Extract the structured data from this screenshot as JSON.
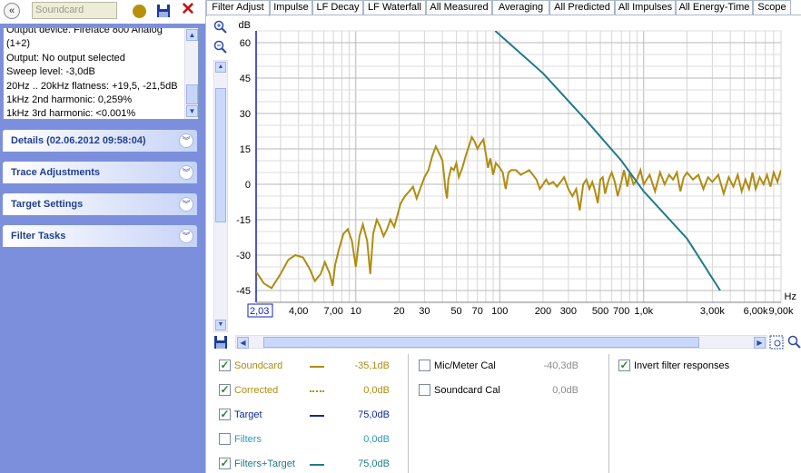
{
  "left_panel": {
    "back_label": "«",
    "measurement_name": "Soundcard",
    "info_lines": [
      "Output device: Fireface 800 Analog",
      "(1+2)",
      "Output: No output selected",
      "Sweep level: -3,0dB",
      "20Hz .. 20kHz flatness: +19,5, -21,5dB",
      "1kHz 2nd harmonic: 0,259%",
      "1kHz 3rd harmonic: <0.001%"
    ],
    "sections": [
      {
        "title": "Details  (02.06.2012 09:58:04)"
      },
      {
        "title": "Trace Adjustments"
      },
      {
        "title": "Target Settings"
      },
      {
        "title": "Filter Tasks"
      }
    ],
    "dot_color": "#b8900c"
  },
  "tabs": [
    {
      "label": "Filter Adjust",
      "active": true
    },
    {
      "label": "Impulse"
    },
    {
      "label": "LF Decay"
    },
    {
      "label": "LF Waterfall"
    },
    {
      "label": "All Measured"
    },
    {
      "label": "Averaging"
    },
    {
      "label": "All Predicted"
    },
    {
      "label": "All Impulses"
    },
    {
      "label": "All Energy-Time"
    },
    {
      "label": "Scope"
    }
  ],
  "chart_data": {
    "type": "line",
    "ylabel": "dB",
    "xlabel": "Hz",
    "xscale": "log",
    "xlim": [
      2.03,
      9000
    ],
    "ylim": [
      -50,
      65
    ],
    "grid": true,
    "y_ticks": [
      "60",
      "45",
      "30",
      "15",
      "0",
      "-15",
      "-30",
      "-45"
    ],
    "x_tick_labels": [
      {
        "x": 2.03,
        "label": "2,03",
        "boxed": true
      },
      {
        "x": 4,
        "label": "4,00"
      },
      {
        "x": 7,
        "label": "7,00"
      },
      {
        "x": 10,
        "label": "10"
      },
      {
        "x": 20,
        "label": "20"
      },
      {
        "x": 30,
        "label": "30"
      },
      {
        "x": 50,
        "label": "50"
      },
      {
        "x": 70,
        "label": "70"
      },
      {
        "x": 100,
        "label": "100"
      },
      {
        "x": 200,
        "label": "200"
      },
      {
        "x": 300,
        "label": "300"
      },
      {
        "x": 500,
        "label": "500"
      },
      {
        "x": 700,
        "label": "700"
      },
      {
        "x": 1000,
        "label": "1,0k"
      },
      {
        "x": 3000,
        "label": "3,00k"
      },
      {
        "x": 6000,
        "label": "6,00k"
      },
      {
        "x": 9000,
        "label": "9,00k"
      }
    ],
    "series": [
      {
        "name": "Soundcard",
        "color": "#b08c10",
        "x": [
          2.03,
          2.3,
          2.6,
          3.0,
          3.4,
          3.8,
          4.3,
          4.8,
          5.2,
          5.7,
          6.1,
          6.6,
          6.9,
          7.2,
          7.6,
          8.2,
          8.8,
          9.4,
          10,
          10.6,
          11.2,
          12,
          12.6,
          13.2,
          14,
          14.8,
          15.6,
          16.5,
          17.4,
          18.5,
          19.5,
          20.5,
          22,
          23.5,
          25,
          26.5,
          28,
          30,
          32,
          34,
          36,
          38,
          40,
          41,
          42,
          43,
          44,
          46,
          48,
          50,
          52,
          55,
          58,
          61,
          64,
          67,
          70,
          73,
          77,
          80,
          83,
          86,
          90,
          94,
          100,
          105,
          110,
          115,
          120,
          130,
          140,
          150,
          160,
          170,
          180,
          190,
          200,
          210,
          220,
          235,
          250,
          265,
          280,
          300,
          320,
          340,
          360,
          380,
          400,
          420,
          440,
          460,
          480,
          500,
          520,
          540,
          560,
          580,
          600,
          630,
          660,
          700,
          730,
          770,
          800,
          850,
          900,
          950,
          1000,
          1100,
          1200,
          1300,
          1400,
          1500,
          1600,
          1700,
          1800,
          1900,
          2000,
          2200,
          2400,
          2600,
          2800,
          3000,
          3300,
          3600,
          3900,
          4200,
          4500,
          4800,
          5100,
          5400,
          5700,
          6000,
          6400,
          6800,
          7200,
          7600,
          8000,
          8500,
          9000
        ],
        "y": [
          -37,
          -42,
          -44,
          -38,
          -32,
          -30,
          -31,
          -36,
          -41,
          -38,
          -33,
          -38,
          -43,
          -34,
          -28,
          -21,
          -19,
          -24,
          -35,
          -22,
          -17,
          -24,
          -38,
          -21,
          -15,
          -18,
          -22,
          -19,
          -15,
          -18,
          -13,
          -8,
          -5,
          -3,
          -1,
          -6,
          -2,
          3,
          6,
          12,
          16,
          13,
          10,
          4,
          -2,
          -6,
          2,
          7,
          6,
          9,
          3,
          7,
          12,
          16,
          20,
          18,
          15,
          17,
          19,
          13,
          7,
          11,
          4,
          9,
          7,
          5,
          -2,
          5,
          6,
          6,
          4,
          5,
          6,
          4,
          2,
          -2,
          0,
          2,
          0,
          1,
          -1,
          1,
          3,
          -2,
          -5,
          -2,
          -11,
          0,
          2,
          -2,
          1,
          -3,
          -8,
          2,
          3,
          -4,
          0,
          3,
          5,
          1,
          -5,
          1,
          6,
          -1,
          5,
          0,
          2,
          6,
          0,
          4,
          -3,
          5,
          0,
          4,
          2,
          5,
          -3,
          3,
          5,
          2,
          4,
          -2,
          3,
          1,
          4,
          -4,
          3,
          -1,
          4,
          -3,
          2,
          -2,
          5,
          -2,
          3,
          0,
          4,
          -1,
          5,
          1,
          6
        ]
      },
      {
        "name": "Filters+Target",
        "color": "#1f7a8c",
        "x": [
          93,
          200,
          400,
          700,
          1000,
          2000,
          3400
        ],
        "y": [
          65,
          47,
          27,
          10,
          -3,
          -23,
          -45
        ]
      }
    ]
  },
  "legend": {
    "col1": [
      {
        "label": "Soundcard",
        "checked": true,
        "color": "#b08c10",
        "style": "solid",
        "value": "-35,1dB"
      },
      {
        "label": "Corrected",
        "checked": true,
        "color": "#b08c10",
        "style": "dotted",
        "value": "0,0dB"
      },
      {
        "label": "Target",
        "checked": true,
        "color": "#0b2aa0",
        "style": "solid",
        "value": "75,0dB"
      },
      {
        "label": "Filters",
        "checked": false,
        "color": "#1f7a8c",
        "style": "none",
        "value": "0,0dB"
      },
      {
        "label": "Filters+Target",
        "checked": true,
        "color": "#1f7a8c",
        "style": "solid",
        "value": "75,0dB"
      }
    ],
    "col2": [
      {
        "label": "Mic/Meter Cal",
        "checked": false,
        "value": "-40,3dB"
      },
      {
        "label": "Soundcard Cal",
        "checked": false,
        "value": "0,0dB"
      }
    ],
    "col3": [
      {
        "label": "Invert filter responses",
        "checked": true
      }
    ]
  }
}
